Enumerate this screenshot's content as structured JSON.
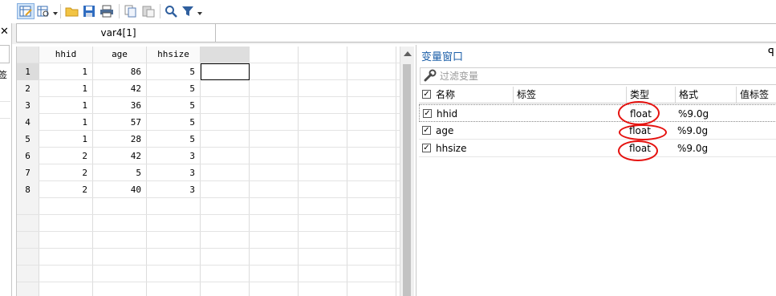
{
  "toolbar": {
    "buttons": [
      {
        "name": "data-editor-edit-icon"
      },
      {
        "name": "data-editor-browse-icon"
      },
      {
        "name": "open-folder-icon"
      },
      {
        "name": "save-icon"
      },
      {
        "name": "print-icon"
      },
      {
        "name": "copy-icon"
      },
      {
        "name": "paste-icon"
      },
      {
        "name": "search-icon"
      },
      {
        "name": "filter-icon"
      }
    ]
  },
  "left_strip": {
    "close_glyph": "✕",
    "label": "签"
  },
  "var_bar": {
    "varname": "var4[1]",
    "value": ""
  },
  "grid": {
    "columns": [
      "hhid",
      "age",
      "hhsize"
    ],
    "rows": [
      {
        "num": "1",
        "hhid": "1",
        "age": "86",
        "hhsize": "5"
      },
      {
        "num": "2",
        "hhid": "1",
        "age": "42",
        "hhsize": "5"
      },
      {
        "num": "3",
        "hhid": "1",
        "age": "36",
        "hhsize": "5"
      },
      {
        "num": "4",
        "hhid": "1",
        "age": "57",
        "hhsize": "5"
      },
      {
        "num": "5",
        "hhid": "1",
        "age": "28",
        "hhsize": "5"
      },
      {
        "num": "6",
        "hhid": "2",
        "age": "42",
        "hhsize": "3"
      },
      {
        "num": "7",
        "hhid": "2",
        "age": "5",
        "hhsize": "3"
      },
      {
        "num": "8",
        "hhid": "2",
        "age": "40",
        "hhsize": "3"
      }
    ]
  },
  "var_pane": {
    "title": "变量窗口",
    "pin_glyph": "ꟼ",
    "filter_placeholder": "过滤变量",
    "headers": {
      "name": "名称",
      "label": "标签",
      "type": "类型",
      "format": "格式",
      "value_label": "值标签"
    },
    "variables": [
      {
        "name": "hhid",
        "label": "",
        "type": "float",
        "format": "%9.0g",
        "value_label": ""
      },
      {
        "name": "age",
        "label": "",
        "type": "float",
        "format": "%9.0g",
        "value_label": ""
      },
      {
        "name": "hhsize",
        "label": "",
        "type": "float",
        "format": "%9.0g",
        "value_label": ""
      }
    ]
  },
  "colors": {
    "accent_title": "#1c5fa8",
    "annotation_red": "#e5120f"
  }
}
